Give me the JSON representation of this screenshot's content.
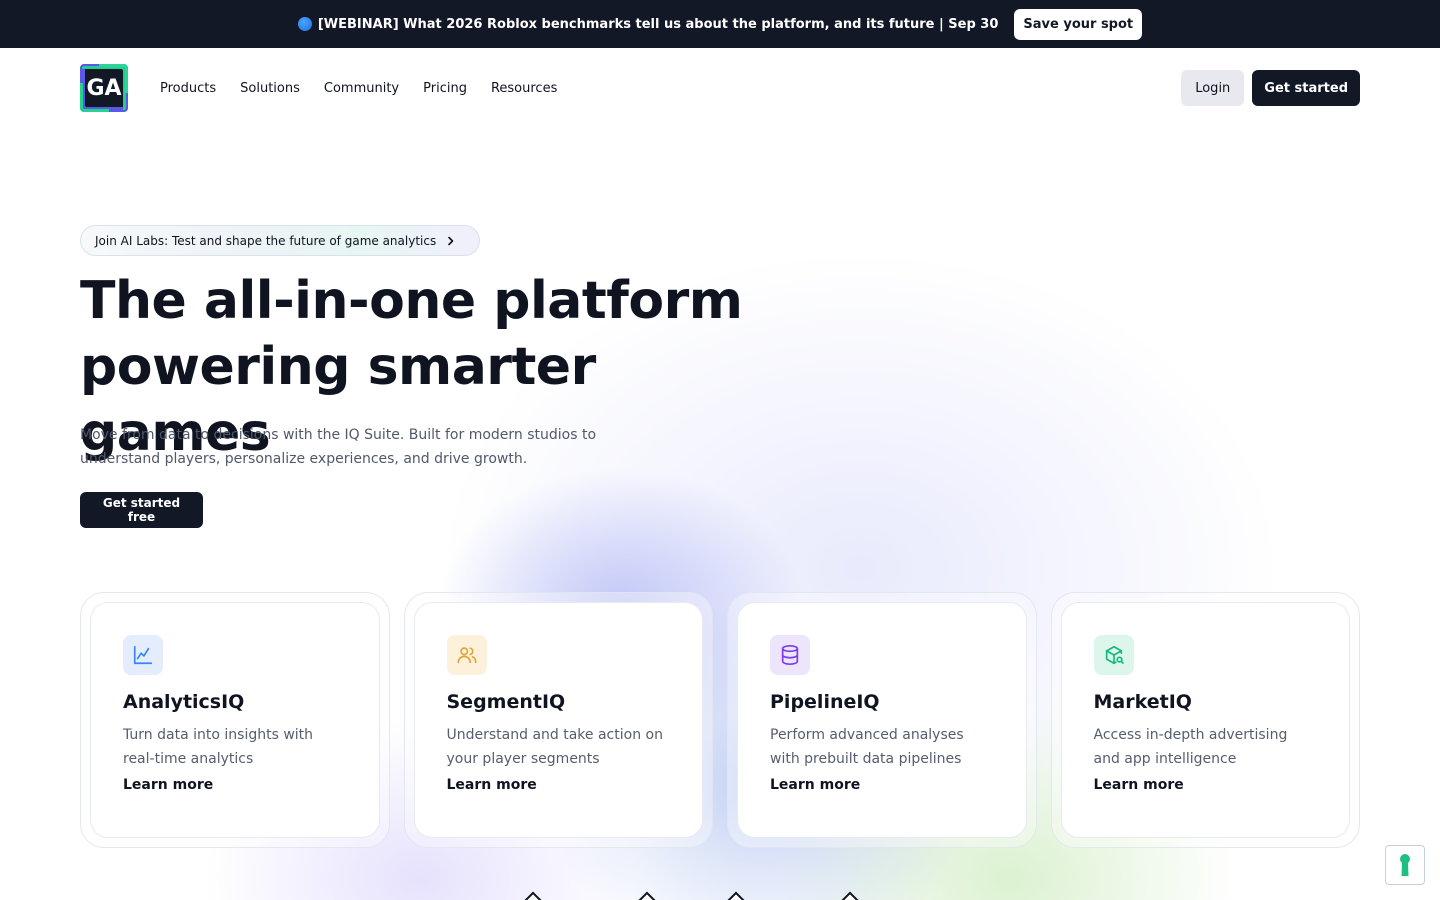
{
  "announcement": {
    "text": "[WEBINAR] What 2026 Roblox benchmarks tell us about the platform, and its future | Sep 30",
    "button_label": "Save your spot"
  },
  "nav": {
    "logo_text": "GA",
    "menu": [
      "Products",
      "Solutions",
      "Community",
      "Pricing",
      "Resources"
    ],
    "login_label": "Login",
    "get_started_label": "Get started"
  },
  "hero": {
    "pill_text": "Join AI Labs: Test and shape the future of game analytics",
    "headline_line1": "The all-in-one platform",
    "headline_line2": "powering smarter games",
    "subtitle": "Move from data to decisions with the IQ Suite. Built for modern studios to understand players, personalize experiences, and drive growth.",
    "cta_label": "Get started free"
  },
  "products": [
    {
      "name": "AnalyticsIQ",
      "description": "Turn data into insights with real-time analytics",
      "link": "Learn more",
      "icon": "line-chart-icon",
      "icon_color": "#3b82f6",
      "icon_bg": "#e3edfd"
    },
    {
      "name": "SegmentIQ",
      "description": "Understand and take action on your player segments",
      "link": "Learn more",
      "icon": "users-icon",
      "icon_color": "#e0a53a",
      "icon_bg": "#fdf1dc"
    },
    {
      "name": "PipelineIQ",
      "description": "Perform advanced analyses with prebuilt data pipelines",
      "link": "Learn more",
      "icon": "database-icon",
      "icon_color": "#7c3aed",
      "icon_bg": "#ece5fc"
    },
    {
      "name": "MarketIQ",
      "description": "Access in-depth advertising and app intelligence",
      "link": "Learn more",
      "icon": "package-search-icon",
      "icon_color": "#14b87e",
      "icon_bg": "#dcf6ec"
    }
  ],
  "colors": {
    "dark": "#121826",
    "text": "#0f1420",
    "muted": "#50586a",
    "accent_green": "#24d38c",
    "accent_purple": "#5a58e6"
  }
}
